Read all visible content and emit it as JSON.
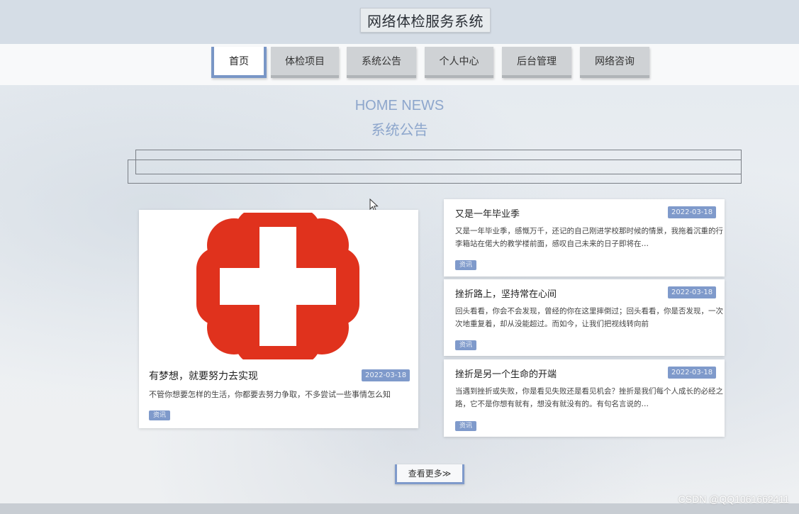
{
  "site": {
    "title": "网络体检服务系统"
  },
  "nav": {
    "items": [
      {
        "label": "首页",
        "active": true
      },
      {
        "label": "体检项目"
      },
      {
        "label": "系统公告"
      },
      {
        "label": "个人中心"
      },
      {
        "label": "后台管理"
      },
      {
        "label": "网络咨询"
      }
    ]
  },
  "section": {
    "heading_en": "HOME NEWS",
    "heading_cn": "系统公告"
  },
  "feature": {
    "title": "有梦想，就要努力去实现",
    "date": "2022-03-18",
    "desc": "不管你想要怎样的生活，你都要去努力争取，不多尝试一些事情怎么知",
    "tag": "资讯",
    "image_icon": "red-cross-icon"
  },
  "news": [
    {
      "title": "又是一年毕业季",
      "date": "2022-03-18",
      "summary": "又是一年毕业季，感慨万千，还记的自己刚进学校那时候的情景，我拖着沉重的行李箱站在偌大的教学楼前面，感叹自己未来的日子即将在…",
      "tag": "资讯"
    },
    {
      "title": "挫折路上，坚持常在心间",
      "date": "2022-03-18",
      "summary": "回头看看，你会不会发现，曾经的你在这里摔倒过；回头看看，你是否发现，一次次地重复着，却从没能超过。而如今，让我们把视线转向前",
      "tag": "资讯"
    },
    {
      "title": "挫折是另一个生命的开端",
      "date": "2022-03-18",
      "summary": "当遇到挫折或失败，你是看见失败还是看见机会？挫折是我们每个人成长的必经之路，它不是你想有就有，想没有就没有的。有句名言说的…",
      "tag": "资讯"
    }
  ],
  "more": {
    "label": "查看更多≫"
  },
  "watermark": "CSDN @QQ1061662411",
  "colors": {
    "accent": "#7f9acb",
    "heading": "#8da6cc",
    "cross": "#e0321d"
  }
}
